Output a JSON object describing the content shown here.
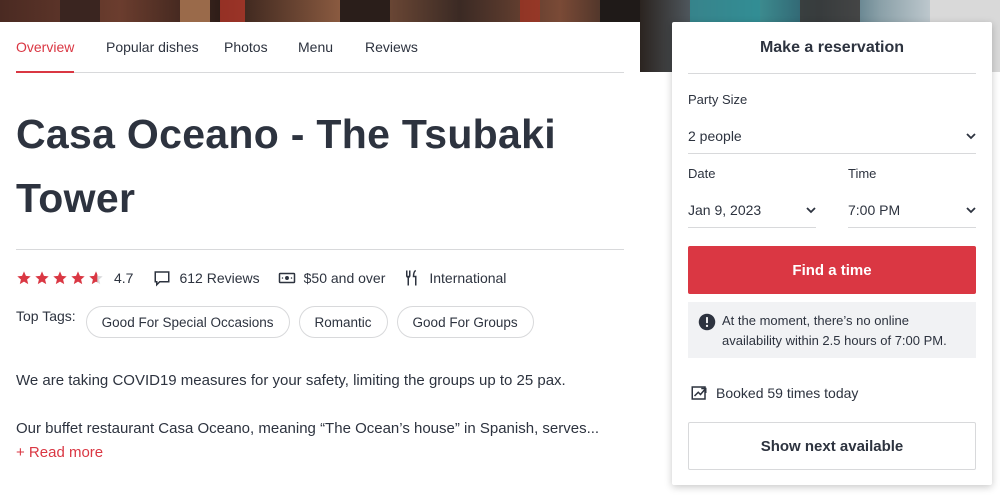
{
  "tabs": [
    "Overview",
    "Popular dishes",
    "Photos",
    "Menu",
    "Reviews"
  ],
  "restaurant": {
    "name": "Casa Oceano - The Tsubaki Tower",
    "rating": "4.7",
    "rating_value": 4.7,
    "reviews": "612 Reviews",
    "price": "$50 and over",
    "cuisine": "International"
  },
  "tags": {
    "label": "Top Tags:",
    "items": [
      "Good For Special Occasions",
      "Romantic",
      "Good For Groups"
    ]
  },
  "description": {
    "line1": "We are taking COVID19 measures for your safety, limiting the groups up to 25 pax.",
    "line2": "Our buffet restaurant Casa Oceano, meaning “The Ocean’s house” in Spanish, serves...",
    "read_more": "+ Read more"
  },
  "reservation": {
    "title": "Make a reservation",
    "party_label": "Party Size",
    "party_value": "2 people",
    "date_label": "Date",
    "date_value": "Jan 9, 2023",
    "time_label": "Time",
    "time_value": "7:00 PM",
    "find_button": "Find a time",
    "notice": "At the moment, there’s no online availability within 2.5 hours of 7:00 PM.",
    "booked": "Booked 59 times today",
    "next_button": "Show next available"
  },
  "colors": {
    "accent": "#da3743",
    "text": "#2d333f",
    "border": "#d8d9db",
    "notice_bg": "#f1f2f4"
  },
  "icons": [
    "star-icon",
    "review-bubble-icon",
    "money-icon",
    "fork-knife-icon",
    "chevron-down-icon",
    "alert-icon",
    "trending-up-icon"
  ]
}
